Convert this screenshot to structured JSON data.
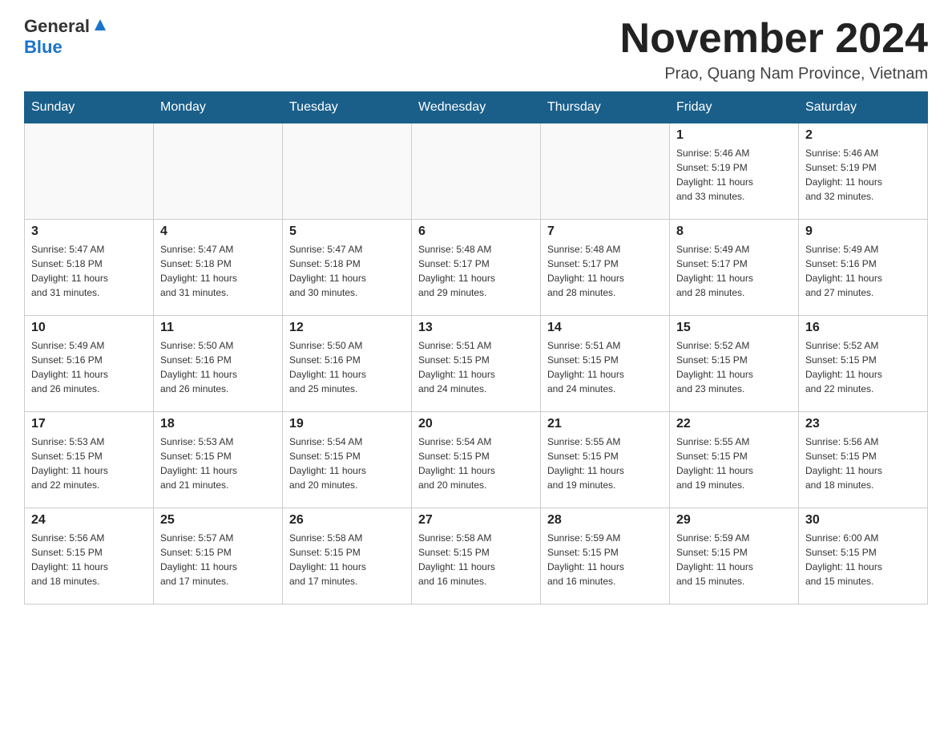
{
  "logo": {
    "general": "General",
    "blue": "Blue",
    "arrow": "▲"
  },
  "title": "November 2024",
  "location": "Prao, Quang Nam Province, Vietnam",
  "weekdays": [
    "Sunday",
    "Monday",
    "Tuesday",
    "Wednesday",
    "Thursday",
    "Friday",
    "Saturday"
  ],
  "weeks": [
    [
      {
        "day": "",
        "info": ""
      },
      {
        "day": "",
        "info": ""
      },
      {
        "day": "",
        "info": ""
      },
      {
        "day": "",
        "info": ""
      },
      {
        "day": "",
        "info": ""
      },
      {
        "day": "1",
        "info": "Sunrise: 5:46 AM\nSunset: 5:19 PM\nDaylight: 11 hours\nand 33 minutes."
      },
      {
        "day": "2",
        "info": "Sunrise: 5:46 AM\nSunset: 5:19 PM\nDaylight: 11 hours\nand 32 minutes."
      }
    ],
    [
      {
        "day": "3",
        "info": "Sunrise: 5:47 AM\nSunset: 5:18 PM\nDaylight: 11 hours\nand 31 minutes."
      },
      {
        "day": "4",
        "info": "Sunrise: 5:47 AM\nSunset: 5:18 PM\nDaylight: 11 hours\nand 31 minutes."
      },
      {
        "day": "5",
        "info": "Sunrise: 5:47 AM\nSunset: 5:18 PM\nDaylight: 11 hours\nand 30 minutes."
      },
      {
        "day": "6",
        "info": "Sunrise: 5:48 AM\nSunset: 5:17 PM\nDaylight: 11 hours\nand 29 minutes."
      },
      {
        "day": "7",
        "info": "Sunrise: 5:48 AM\nSunset: 5:17 PM\nDaylight: 11 hours\nand 28 minutes."
      },
      {
        "day": "8",
        "info": "Sunrise: 5:49 AM\nSunset: 5:17 PM\nDaylight: 11 hours\nand 28 minutes."
      },
      {
        "day": "9",
        "info": "Sunrise: 5:49 AM\nSunset: 5:16 PM\nDaylight: 11 hours\nand 27 minutes."
      }
    ],
    [
      {
        "day": "10",
        "info": "Sunrise: 5:49 AM\nSunset: 5:16 PM\nDaylight: 11 hours\nand 26 minutes."
      },
      {
        "day": "11",
        "info": "Sunrise: 5:50 AM\nSunset: 5:16 PM\nDaylight: 11 hours\nand 26 minutes."
      },
      {
        "day": "12",
        "info": "Sunrise: 5:50 AM\nSunset: 5:16 PM\nDaylight: 11 hours\nand 25 minutes."
      },
      {
        "day": "13",
        "info": "Sunrise: 5:51 AM\nSunset: 5:15 PM\nDaylight: 11 hours\nand 24 minutes."
      },
      {
        "day": "14",
        "info": "Sunrise: 5:51 AM\nSunset: 5:15 PM\nDaylight: 11 hours\nand 24 minutes."
      },
      {
        "day": "15",
        "info": "Sunrise: 5:52 AM\nSunset: 5:15 PM\nDaylight: 11 hours\nand 23 minutes."
      },
      {
        "day": "16",
        "info": "Sunrise: 5:52 AM\nSunset: 5:15 PM\nDaylight: 11 hours\nand 22 minutes."
      }
    ],
    [
      {
        "day": "17",
        "info": "Sunrise: 5:53 AM\nSunset: 5:15 PM\nDaylight: 11 hours\nand 22 minutes."
      },
      {
        "day": "18",
        "info": "Sunrise: 5:53 AM\nSunset: 5:15 PM\nDaylight: 11 hours\nand 21 minutes."
      },
      {
        "day": "19",
        "info": "Sunrise: 5:54 AM\nSunset: 5:15 PM\nDaylight: 11 hours\nand 20 minutes."
      },
      {
        "day": "20",
        "info": "Sunrise: 5:54 AM\nSunset: 5:15 PM\nDaylight: 11 hours\nand 20 minutes."
      },
      {
        "day": "21",
        "info": "Sunrise: 5:55 AM\nSunset: 5:15 PM\nDaylight: 11 hours\nand 19 minutes."
      },
      {
        "day": "22",
        "info": "Sunrise: 5:55 AM\nSunset: 5:15 PM\nDaylight: 11 hours\nand 19 minutes."
      },
      {
        "day": "23",
        "info": "Sunrise: 5:56 AM\nSunset: 5:15 PM\nDaylight: 11 hours\nand 18 minutes."
      }
    ],
    [
      {
        "day": "24",
        "info": "Sunrise: 5:56 AM\nSunset: 5:15 PM\nDaylight: 11 hours\nand 18 minutes."
      },
      {
        "day": "25",
        "info": "Sunrise: 5:57 AM\nSunset: 5:15 PM\nDaylight: 11 hours\nand 17 minutes."
      },
      {
        "day": "26",
        "info": "Sunrise: 5:58 AM\nSunset: 5:15 PM\nDaylight: 11 hours\nand 17 minutes."
      },
      {
        "day": "27",
        "info": "Sunrise: 5:58 AM\nSunset: 5:15 PM\nDaylight: 11 hours\nand 16 minutes."
      },
      {
        "day": "28",
        "info": "Sunrise: 5:59 AM\nSunset: 5:15 PM\nDaylight: 11 hours\nand 16 minutes."
      },
      {
        "day": "29",
        "info": "Sunrise: 5:59 AM\nSunset: 5:15 PM\nDaylight: 11 hours\nand 15 minutes."
      },
      {
        "day": "30",
        "info": "Sunrise: 6:00 AM\nSunset: 5:15 PM\nDaylight: 11 hours\nand 15 minutes."
      }
    ]
  ]
}
